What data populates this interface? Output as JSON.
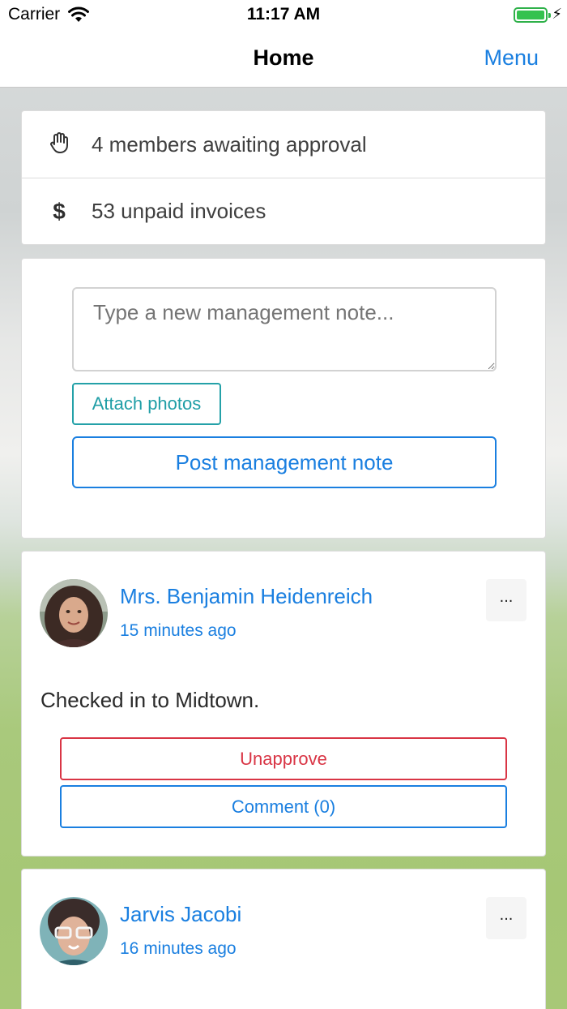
{
  "status_bar": {
    "carrier": "Carrier",
    "time": "11:17 AM",
    "wifi_icon": "wifi-icon",
    "battery_icon": "battery-icon",
    "charging_icon": "charging-bolt-icon"
  },
  "nav": {
    "title": "Home",
    "menu_label": "Menu"
  },
  "summary": {
    "items": [
      {
        "icon": "hand-icon",
        "text": "4 members awaiting approval"
      },
      {
        "icon": "dollar-icon",
        "glyph": "$",
        "text": "53 unpaid invoices"
      }
    ]
  },
  "note_form": {
    "placeholder": "Type a new management note...",
    "attach_label": "Attach photos",
    "post_label": "Post management note"
  },
  "posts": [
    {
      "author": "Mrs. Benjamin Heidenreich",
      "time": "15 minutes ago",
      "more_label": "...",
      "body": "Checked in to Midtown.",
      "unapprove_label": "Unapprove",
      "comment_label": "Comment (0)"
    },
    {
      "author": "Jarvis Jacobi",
      "time": "16 minutes ago",
      "more_label": "..."
    }
  ],
  "colors": {
    "accent": "#1a7fe0",
    "teal": "#1f9ea6",
    "danger": "#d93545",
    "battery": "#35c24f"
  }
}
